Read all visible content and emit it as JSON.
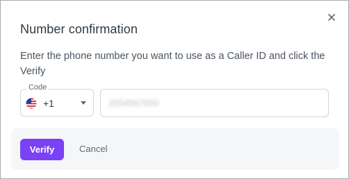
{
  "dialog": {
    "title": "Number confirmation",
    "description": "Enter the phone number you want to use as a Caller ID and click the Verify"
  },
  "code_field": {
    "label": "Code",
    "value": "+1",
    "flag_icon": "us-flag-icon"
  },
  "phone_field": {
    "value": "2054567000"
  },
  "actions": {
    "verify_label": "Verify",
    "cancel_label": "Cancel"
  },
  "colors": {
    "accent": "#7a42f4",
    "footer_bg": "#f4f6f8",
    "border": "#cfd6dc"
  }
}
